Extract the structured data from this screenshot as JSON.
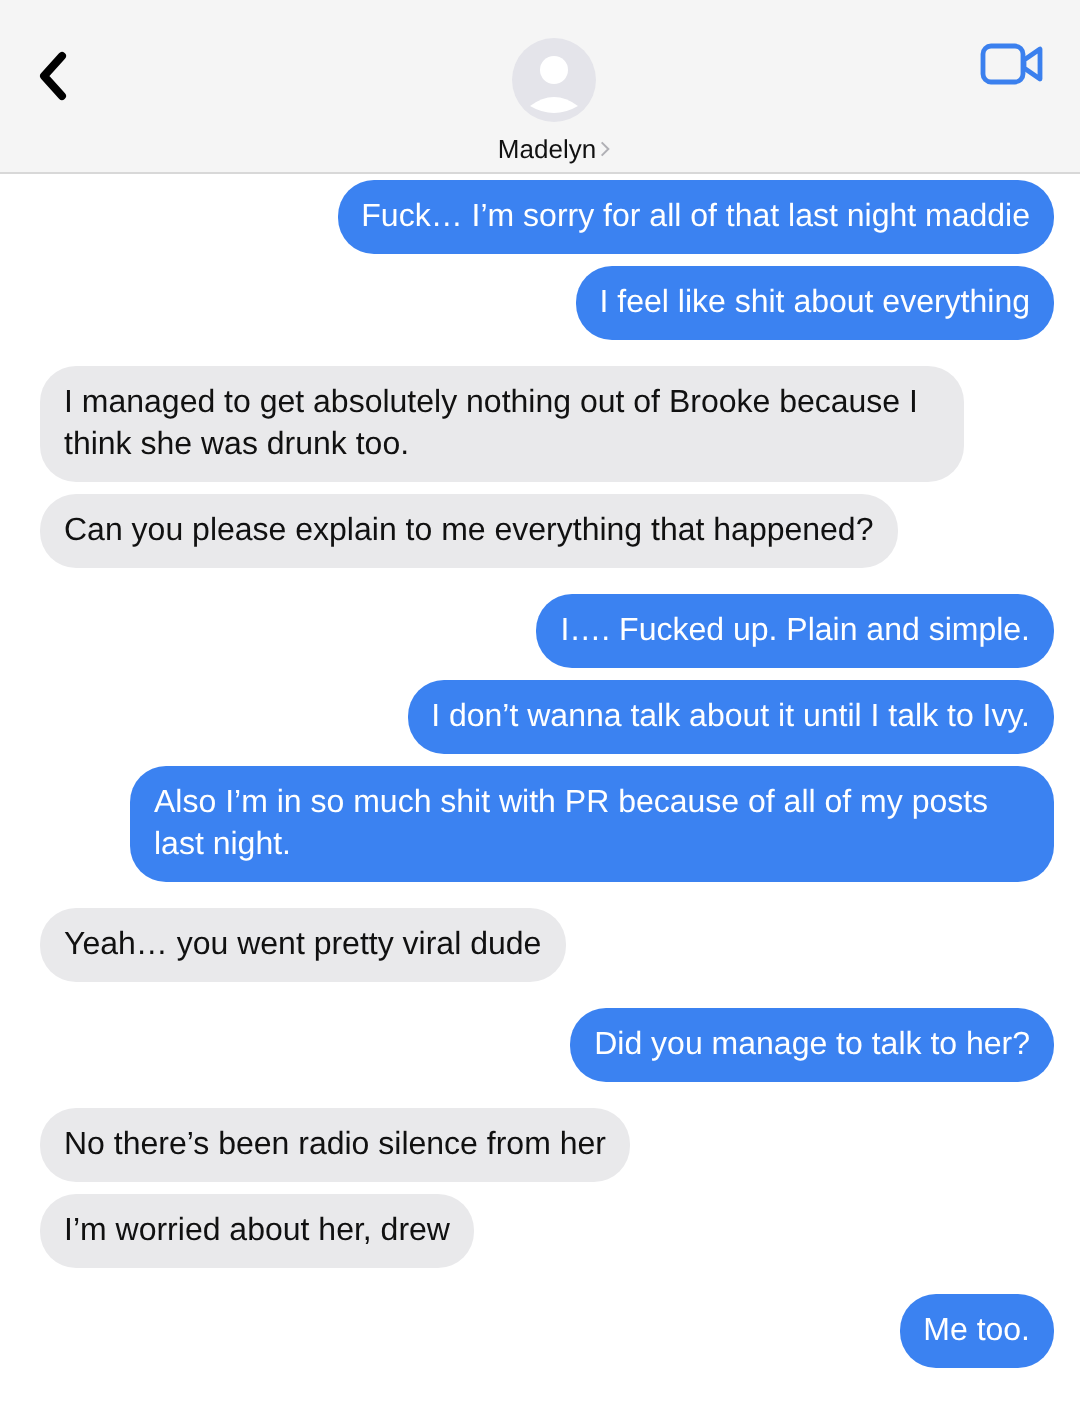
{
  "header": {
    "contact_name": "Madelyn"
  },
  "messages": [
    {
      "kind": "sent",
      "text": "Fuck… I’m sorry for all of that last night maddie"
    },
    {
      "kind": "sent",
      "text": "I feel like shit about everything"
    },
    {
      "kind": "received",
      "text": "I managed to get absolutely nothing out of Brooke because I think she was drunk too."
    },
    {
      "kind": "received",
      "text": "Can you please explain to me everything that happened?"
    },
    {
      "kind": "sent",
      "text": "I…. Fucked up. Plain and simple."
    },
    {
      "kind": "sent",
      "text": "I don’t wanna talk about it until I talk to Ivy."
    },
    {
      "kind": "sent",
      "text": "Also I’m in so much shit with PR because of all of my posts last night."
    },
    {
      "kind": "received",
      "text": "Yeah… you went pretty viral dude"
    },
    {
      "kind": "sent",
      "text": "Did you manage to talk to her?"
    },
    {
      "kind": "received",
      "text": "No there’s been radio silence from her"
    },
    {
      "kind": "received",
      "text": "I’m worried about her, drew"
    },
    {
      "kind": "sent",
      "text": "Me too."
    }
  ]
}
